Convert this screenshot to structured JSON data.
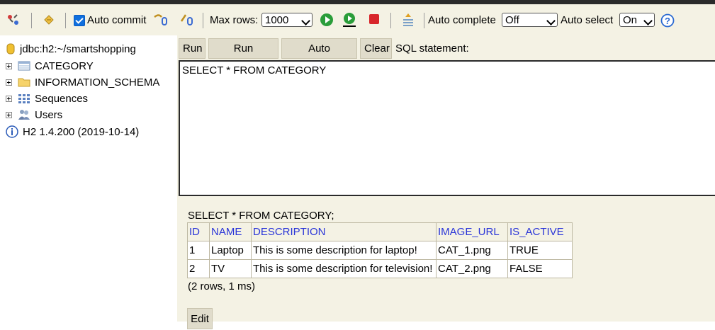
{
  "toolbar": {
    "auto_commit_label": "Auto commit",
    "max_rows_label": "Max rows:",
    "max_rows_value": "1000",
    "auto_complete_label": "Auto complete",
    "auto_complete_value": "Off",
    "auto_select_label": "Auto select",
    "auto_select_value": "On",
    "icons": [
      "disconnect-icon",
      "refresh-icon",
      "rollback-icon",
      "commit-icon",
      "run-icon",
      "run-selected-icon",
      "stop-icon",
      "history-icon",
      "help-icon"
    ]
  },
  "sidebar": {
    "connection": "jdbc:h2:~/smartshopping",
    "items": [
      {
        "label": "CATEGORY",
        "icon": "table-icon"
      },
      {
        "label": "INFORMATION_SCHEMA",
        "icon": "folder-icon"
      },
      {
        "label": "Sequences",
        "icon": "sequences-icon"
      },
      {
        "label": "Users",
        "icon": "users-icon"
      }
    ],
    "version": "H2 1.4.200 (2019-10-14)"
  },
  "main": {
    "buttons": {
      "run": "Run",
      "run_selected": "Run Selected",
      "auto_complete": "Auto complete",
      "clear": "Clear"
    },
    "sql_label": "SQL statement:",
    "sql_text": "SELECT * FROM CATEGORY",
    "result_title": "SELECT * FROM CATEGORY;",
    "table": {
      "headers": [
        "ID",
        "NAME",
        "DESCRIPTION",
        "IMAGE_URL",
        "IS_ACTIVE"
      ],
      "rows": [
        [
          "1",
          "Laptop",
          "This is some description for laptop!",
          "CAT_1.png",
          "TRUE"
        ],
        [
          "2",
          "TV",
          "This is some description for television!",
          "CAT_2.png",
          "FALSE"
        ]
      ]
    },
    "row_count": "(2 rows, 1 ms)",
    "edit_button": "Edit"
  },
  "colors": {
    "toolbar_bg": "#f4f2e4",
    "header_link": "#2a35d8",
    "run_green": "#2a9d3a",
    "stop_red": "#d8262b"
  }
}
